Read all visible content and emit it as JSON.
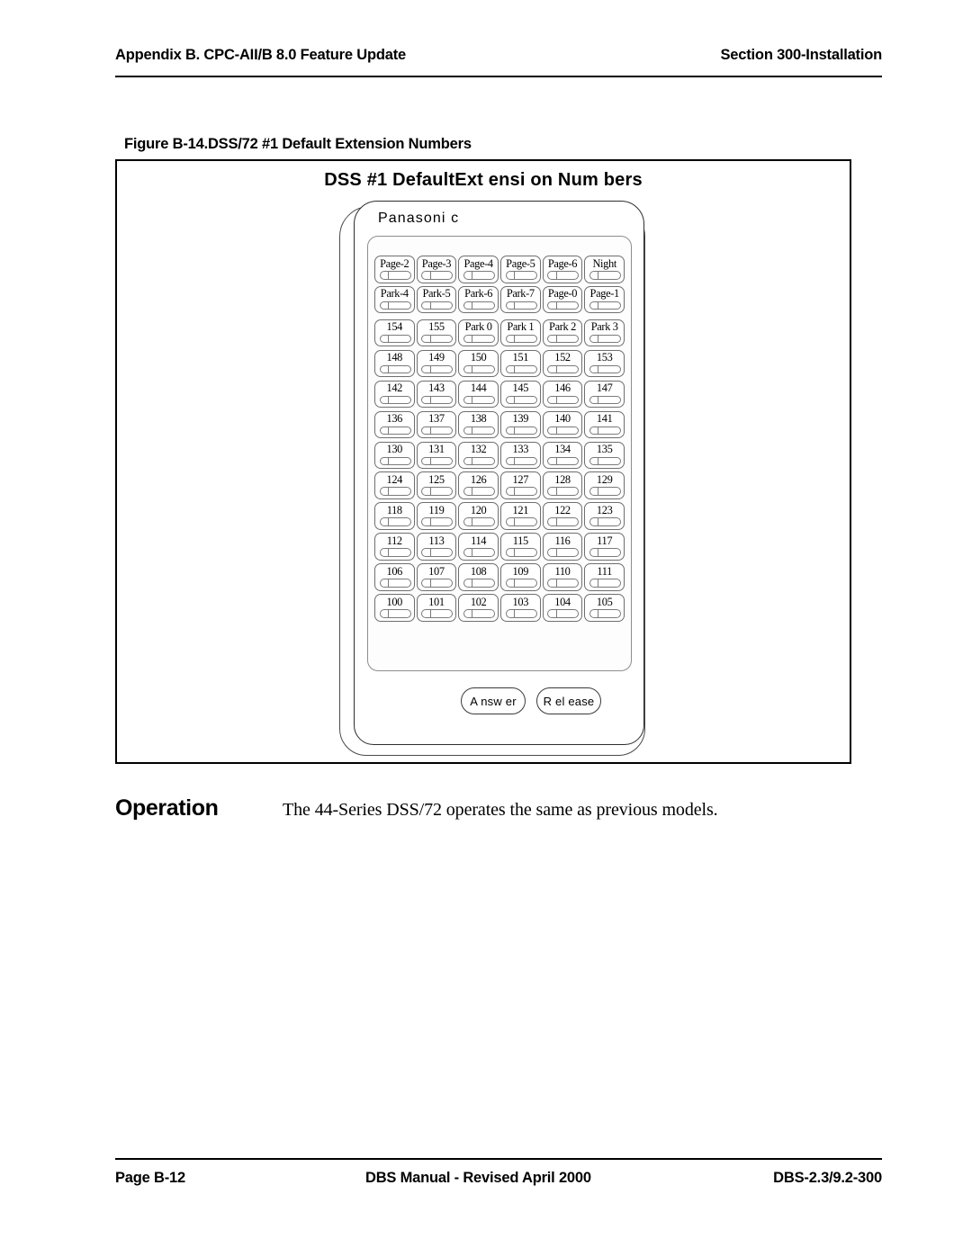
{
  "page": {
    "header": {
      "left": "Appendix B. CPC-AII/B 8.0 Feature Update",
      "right": "Section 300-Installation"
    },
    "footer": {
      "left": "Page B-12",
      "center": "DBS Manual - Revised April 2000",
      "right": "DBS-2.3/9.2-300"
    }
  },
  "figure": {
    "caption": "Figure B-14.DSS/72 #1 Default Extension Numbers",
    "inner_title": "DSS #1 DefaultExt ensi on Num bers",
    "device": {
      "brand": "Panasoni c",
      "columns": 6,
      "rows": 14,
      "key_rows": [
        [
          "Page-2",
          "Page-3",
          "Page-4",
          "Page-5",
          "Page-6",
          "Night"
        ],
        [
          "Park-4",
          "Park-5",
          "Park-6",
          "Park-7",
          "Page-0",
          "Page-1"
        ],
        [
          "154",
          "155",
          "Park 0",
          "Park 1",
          "Park 2",
          "Park 3"
        ],
        [
          "148",
          "149",
          "150",
          "151",
          "152",
          "153"
        ],
        [
          "142",
          "143",
          "144",
          "145",
          "146",
          "147"
        ],
        [
          "136",
          "137",
          "138",
          "139",
          "140",
          "141"
        ],
        [
          "130",
          "131",
          "132",
          "133",
          "134",
          "135"
        ],
        [
          "124",
          "125",
          "126",
          "127",
          "128",
          "129"
        ],
        [
          "118",
          "119",
          "120",
          "121",
          "122",
          "123"
        ],
        [
          "112",
          "113",
          "114",
          "115",
          "116",
          "117"
        ],
        [
          "106",
          "107",
          "108",
          "109",
          "110",
          "111"
        ],
        [
          "100",
          "101",
          "102",
          "103",
          "104",
          "105"
        ]
      ],
      "soft_keys": [
        {
          "label": "A nsw er",
          "name": "answer-key"
        },
        {
          "label": "R el ease",
          "name": "release-key"
        }
      ]
    }
  },
  "operation": {
    "heading": "Operation",
    "body": "The 44-Series DSS/72 operates the same as previous models."
  },
  "colors": {
    "text": "#000000",
    "rule": "#000000",
    "key_outline": "#6f6f6f",
    "panel_outline": "#8d8d8d",
    "shell_outline": "#4a4a4a",
    "background": "#ffffff"
  }
}
